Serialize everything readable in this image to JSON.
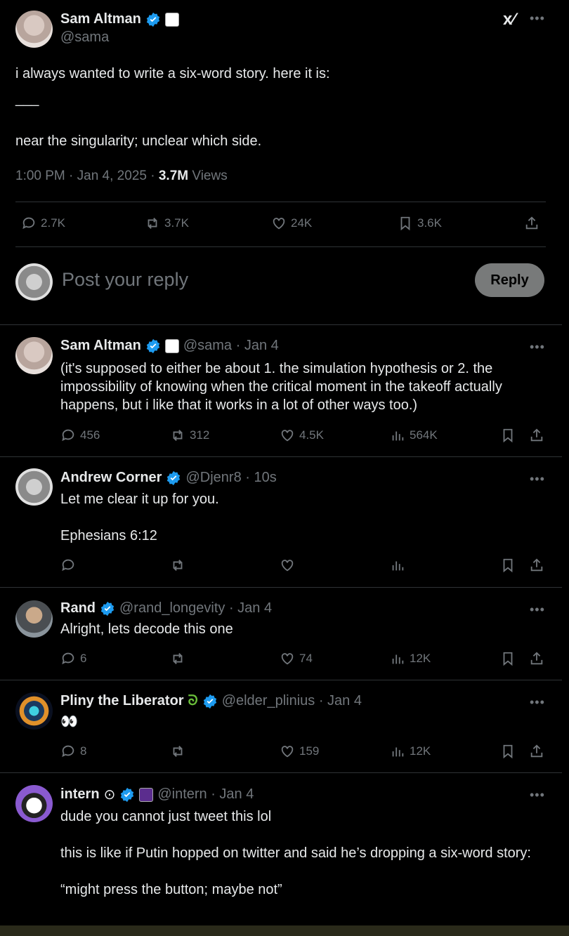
{
  "main_post": {
    "name": "Sam Altman",
    "handle": "@sama",
    "line1": "i always wanted to write a six-word story. here it is:",
    "separator": "___",
    "line2": "near the singularity; unclear which side.",
    "timestamp": "1:00 PM · Jan 4, 2025 · ",
    "views_count": "3.7M",
    "views_label": " Views",
    "stats": {
      "replies": "2.7K",
      "reposts": "3.7K",
      "likes": "24K",
      "bookmarks": "3.6K"
    }
  },
  "compose": {
    "placeholder": "Post your reply",
    "button": "Reply"
  },
  "replies": [
    {
      "name": "Sam Altman",
      "handle": "@sama · Jan 4",
      "text": "(it's supposed to either be about 1. the simulation hypothesis or 2. the impossibility of knowing when the critical moment in the takeoff actually happens, but i like that it works in a lot of other ways too.)",
      "replies": "456",
      "reposts": "312",
      "likes": "4.5K",
      "views": "564K"
    },
    {
      "name": "Andrew Corner",
      "handle": "@Djenr8 · 10s",
      "text": "Let me clear it up for you.\n\nEphesians 6:12",
      "replies": "",
      "reposts": "",
      "likes": "",
      "views": ""
    },
    {
      "name": "Rand",
      "handle": "@rand_longevity · Jan 4",
      "text": "Alright, lets decode this one",
      "replies": "6",
      "reposts": "",
      "likes": "74",
      "views": "12K"
    },
    {
      "name": "Pliny the Liberator",
      "handle": "@elder_plinius · Jan 4",
      "text": "👀",
      "replies": "8",
      "reposts": "",
      "likes": "159",
      "views": "12K"
    },
    {
      "name": "intern",
      "handle": "@intern · Jan 4",
      "text": "dude you cannot just tweet this lol\n\nthis is like if Putin hopped on twitter and said he’s dropping a six-word story:\n\n“might press the button; maybe not”",
      "replies": "",
      "reposts": "",
      "likes": "",
      "views": ""
    }
  ],
  "icons": {
    "verified_color": "#1d9bf0",
    "accent": "#1d9bf0"
  }
}
